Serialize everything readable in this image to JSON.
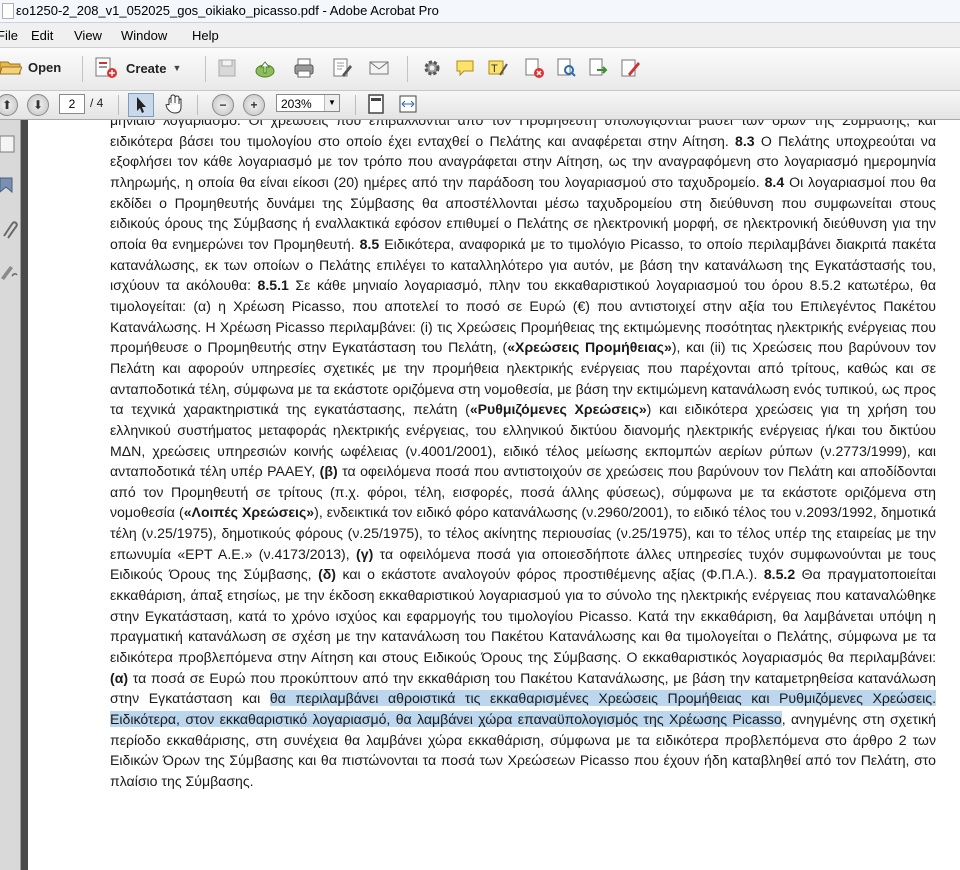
{
  "window": {
    "title": "εο1250-2_208_v1_052025_gos_oikiako_picasso.pdf - Adobe Acrobat Pro"
  },
  "menu": {
    "items": [
      "File",
      "Edit",
      "View",
      "Window",
      "Help"
    ]
  },
  "toolbar": {
    "open_label": "Open",
    "create_label": "Create"
  },
  "nav": {
    "page_number": "2",
    "page_total": "/ 4",
    "zoom": "203%"
  },
  "document": {
    "segments": [
      {
        "text": "μηνιαίο λογαριασμό. Οι χρεώσεις που επιβάλλονται από τον Προμηθευτή υπολογίζονται βάσει των όρων της Σύμβασης, και ειδικότερα βάσει του τιμολογίου στο οποίο έχει ενταχθεί ο Πελάτης και αναφέρεται στην Αίτηση. "
      },
      {
        "text": "8.3",
        "bold": true
      },
      {
        "text": " Ο Πελάτης υποχρεούται να εξοφλήσει τον κάθε λογαριασμό με τον τρόπο που αναγράφεται στην Αίτηση, ως την αναγραφόμενη στο λογαριασμό ημερομηνία πληρωμής, η οποία θα είναι είκοσι (20) ημέρες από την παράδοση του λογαριασμού στο ταχυδρομείο. "
      },
      {
        "text": "8.4",
        "bold": true
      },
      {
        "text": " Οι λογαριασμοί που θα εκδίδει ο Προμηθευτής δυνάμει της Σύμβασης θα αποστέλλονται μέσω ταχυδρομείου στη διεύθυνση που συμφωνείται στους ειδικούς όρους της Σύμβασης ή εναλλακτικά εφόσον επιθυμεί ο Πελάτης σε ηλεκτρονική μορφή, σε ηλεκτρονική διεύθυνση για την οποία θα ενημερώνει τον Προμηθευτή. "
      },
      {
        "text": "8.5",
        "bold": true
      },
      {
        "text": " Ειδικότερα, αναφορικά με το τιμολόγιο Picasso, το οποίο περιλαμβάνει διακριτά πακέτα κατανάλωσης, εκ των οποίων ο Πελάτης επιλέγει το καταλληλότερο για αυτόν, με βάση την κατανάλωση της Εγκατάστασής του, ισχύουν τα ακόλουθα: "
      },
      {
        "text": "8.5.1",
        "bold": true
      },
      {
        "text": " Σε κάθε μηνιαίο λογαριασμό, πλην του εκκαθαριστικού λογαριασμού του όρου 8.5.2 κατωτέρω, θα τιμολογείται: (α) η Χρέωση Picasso, που αποτελεί το ποσό σε Ευρώ (€) που αντιστοιχεί στην αξία του Επιλεγέντος Πακέτου Κατανάλωσης. Η Χρέωση Picasso περιλαμβάνει: (i) τις Χρεώσεις Προμήθειας της εκτιμώμενης ποσότητας ηλεκτρικής ενέργειας που προμήθευσε ο Προμηθευτής στην Εγκατάσταση του Πελάτη, ("
      },
      {
        "text": "«Χρεώσεις Προμήθειας»",
        "bold": true
      },
      {
        "text": "), και (ii) τις Χρεώσεις που βαρύνουν τον Πελάτη και αφορούν υπηρεσίες σχετικές με την προμήθεια ηλεκτρικής ενέργειας που παρέχονται από τρίτους, καθώς και σε ανταποδοτικά τέλη, σύμφωνα με τα εκάστοτε οριζόμενα στη νομοθεσία, με βάση την εκτιμώμενη κατανάλωση ενός τυπικού, ως προς τα τεχνικά χαρακτηριστικά της εγκατάστασης, πελάτη ("
      },
      {
        "text": "«Ρυθμιζόμενες Χρεώσεις»",
        "bold": true
      },
      {
        "text": ") και ειδικότερα χρεώσεις για τη χρήση του ελληνικού συστήματος μεταφοράς ηλεκτρικής ενέργειας, του ελληνικού δικτύου διανομής ηλεκτρικής ενέργειας ή/και του δικτύου ΜΔΝ, χρεώσεις υπηρεσιών κοινής ωφέλειας (ν.4001/2001), ειδικό τέλος μείωσης εκπομπών αερίων ρύπων (ν.2773/1999), και ανταποδοτικά τέλη υπέρ ΡΑΑΕΥ, "
      },
      {
        "text": "(β)",
        "bold": true
      },
      {
        "text": " τα οφειλόμενα ποσά που αντιστοιχούν σε χρεώσεις που βαρύνουν τον Πελάτη και αποδίδονται από τον Προμηθευτή σε τρίτους (π.χ. φόροι, τέλη, εισφορές, ποσά άλλης φύσεως), σύμφωνα με τα εκάστοτε οριζόμενα στη νομοθεσία ("
      },
      {
        "text": "«Λοιπές Χρεώσεις»",
        "bold": true
      },
      {
        "text": "), ενδεικτικά τον ειδικό φόρο κατανάλωσης (ν.2960/2001), το ειδικό τέλος του ν.2093/1992, δημοτικά τέλη (ν.25/1975), δημοτικούς φόρους (ν.25/1975), το τέλος ακίνητης περιουσίας (ν.25/1975), και το τέλος υπέρ της εταιρείας με την επωνυμία «ΕΡΤ Α.Ε.» (ν.4173/2013), "
      },
      {
        "text": "(γ)",
        "bold": true
      },
      {
        "text": " τα οφειλόμενα ποσά για οποιεσδήποτε άλλες υπηρεσίες τυχόν συμφωνούνται με τους Ειδικούς Όρους της Σύμβασης, "
      },
      {
        "text": "(δ)",
        "bold": true
      },
      {
        "text": " και ο εκάστοτε αναλογούν φόρος προστιθέμενης αξίας (Φ.Π.Α.). "
      },
      {
        "text": "8.5.2",
        "bold": true
      },
      {
        "text": " Θα πραγματοποιείται εκκαθάριση, άπαξ ετησίως, με την έκδοση εκκαθαριστικού λογαριασμού για το σύνολο της ηλεκτρικής ενέργειας που καταναλώθηκε στην Εγκατάσταση, κατά το χρόνο ισχύος και εφαρμογής του τιμολογίου Picasso. Κατά την εκκαθάριση, θα λαμβάνεται υπόψη η πραγματική κατανάλωση σε σχέση με την κατανάλωση του Πακέτου Κατανάλωσης και θα τιμολογείται ο Πελάτης, σύμφωνα με τα ειδικότερα προβλεπόμενα στην Αίτηση και στους Ειδικούς Όρους της Σύμβασης. Ο εκκαθαριστικός λογαριασμός θα περιλαμβάνει: "
      },
      {
        "text": "(α)",
        "bold": true
      },
      {
        "text": " τα ποσά σε Ευρώ που προκύπτουν από την εκκαθάριση του Πακέτου Κατανάλωσης, με βάση την καταμετρηθείσα κατανάλωση στην Εγκατάσταση και "
      },
      {
        "text": "θα περιλαμβάνει αθροιστικά τις εκκαθαρισμένες Χρεώσεις Προμήθειας και Ρυθμιζόμενες Χρεώσεις. Ειδικότερα, στον εκκαθαριστικό λογαριασμό, θα λαμβάνει χώρα επαναϋπολογισμός της Χρέωσης Picasso",
        "highlight": true
      },
      {
        "text": ", ανηγμένης στη σχετική περίοδο εκκαθάρισης, στη συνέχεια θα λαμβάνει χώρα εκκαθάριση, σύμφωνα με τα ειδικότερα προβλεπόμενα στο άρθρο 2 των Ειδικών Όρων της Σύμβασης και θα πιστώνονται τα ποσά των Χρεώσεων Picasso που έχουν ήδη καταβληθεί από τον Πελάτη, στο πλαίσιο της Σύμβασης."
      }
    ]
  }
}
